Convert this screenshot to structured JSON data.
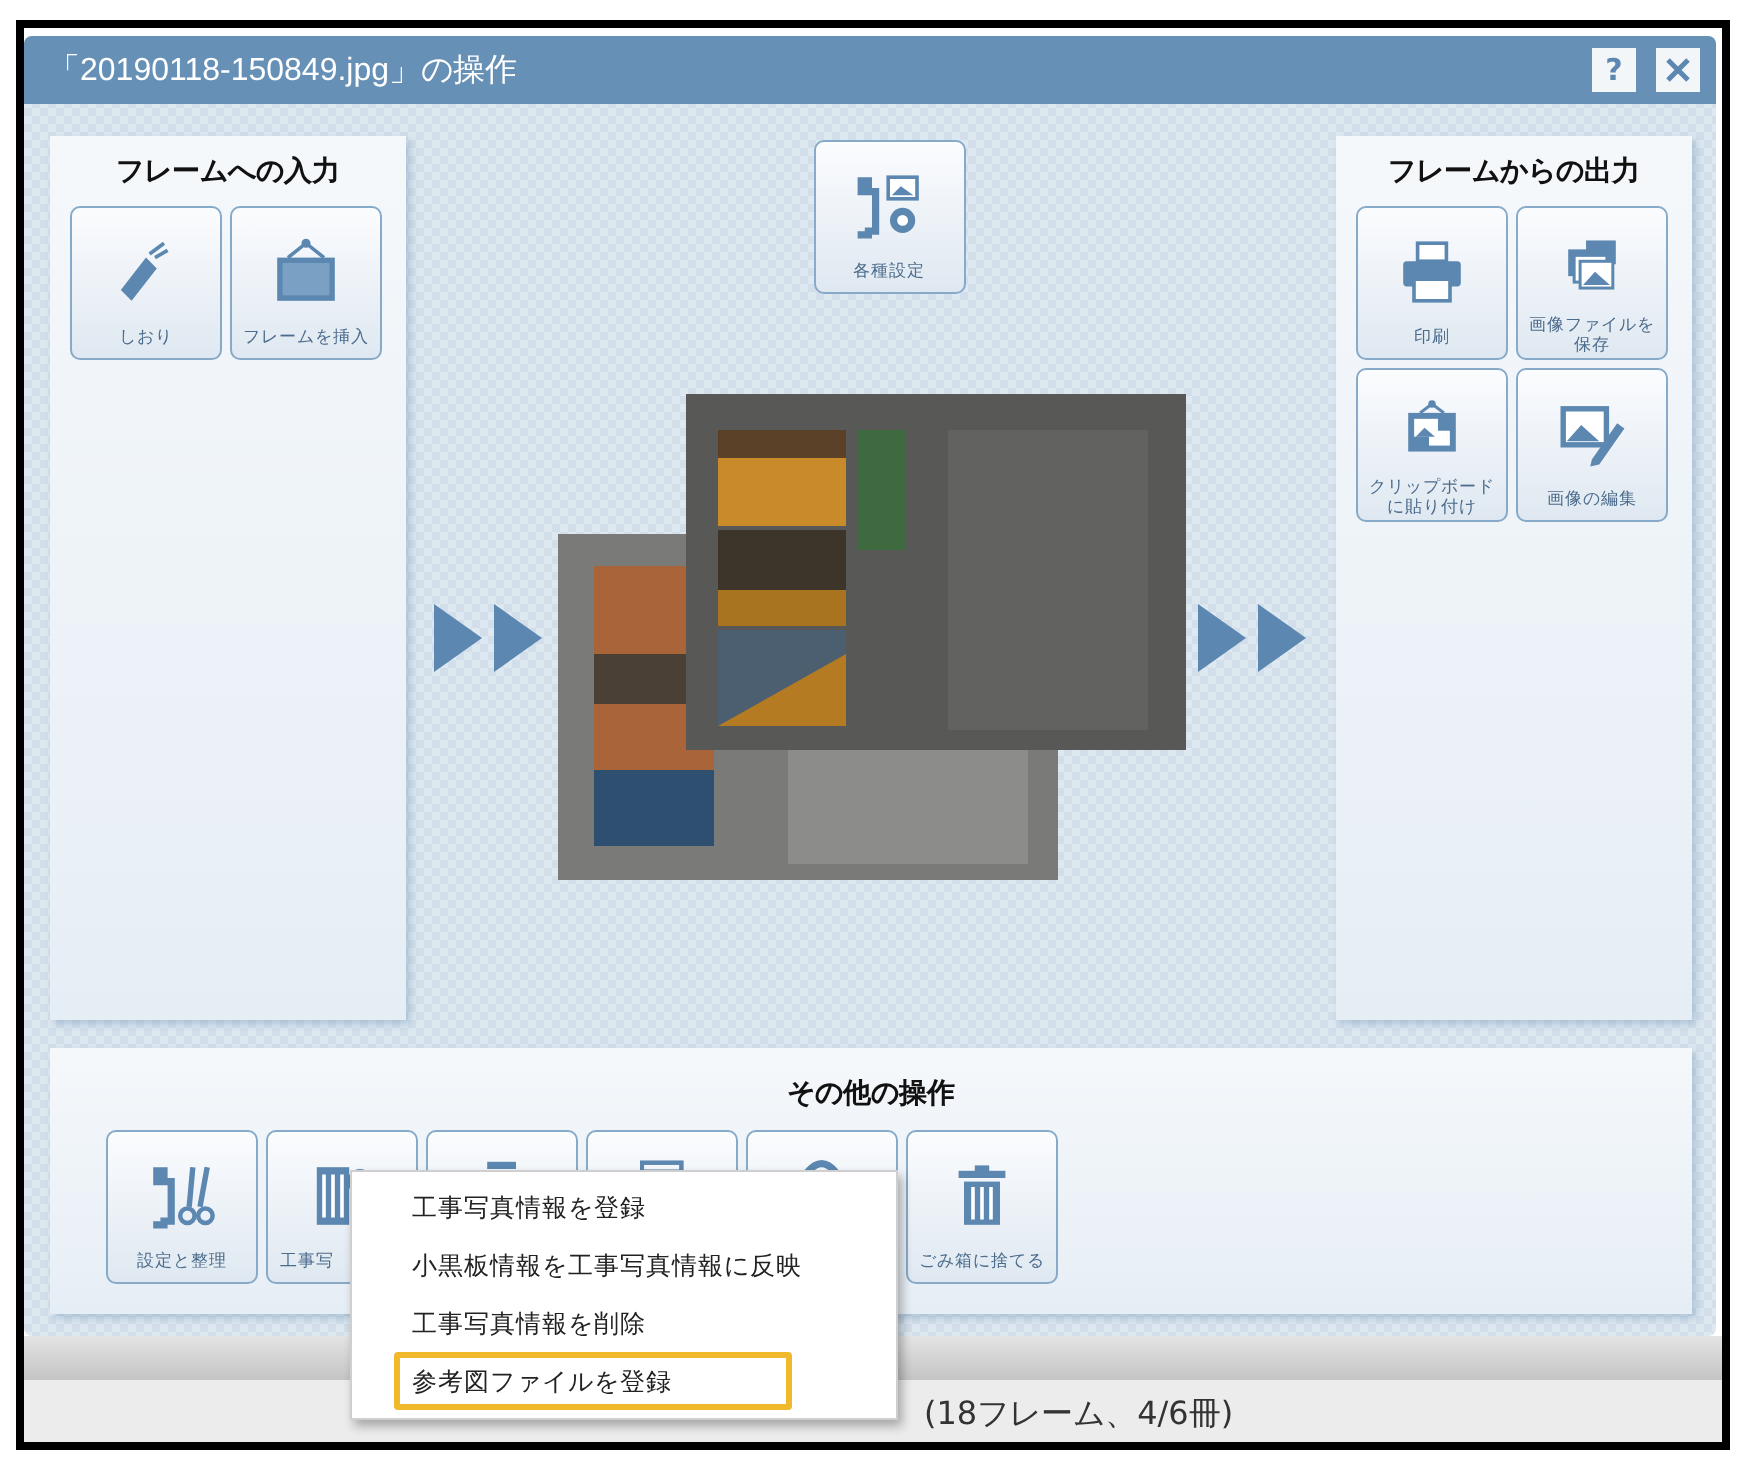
{
  "window": {
    "title": "「20190118-150849.jpg」の操作",
    "help_button": "?"
  },
  "input_panel": {
    "title": "フレームへの入力",
    "buttons": [
      {
        "kind": "bookmark",
        "label": "しおり"
      },
      {
        "kind": "frame",
        "label": "フレームを挿入"
      }
    ]
  },
  "settings_button": {
    "kind": "settings",
    "label": "各種設定"
  },
  "output_panel": {
    "title": "フレームからの出力",
    "buttons": [
      {
        "kind": "printer",
        "label": "印刷"
      },
      {
        "kind": "images",
        "label": "画像ファイルを保存"
      },
      {
        "kind": "clipboard",
        "label": "クリップボードに貼り付け"
      },
      {
        "kind": "edit",
        "label": "画像の編集"
      }
    ]
  },
  "other_panel": {
    "title": "その他の操作",
    "buttons": [
      {
        "kind": "tools",
        "label": "設定と整理"
      },
      {
        "kind": "building",
        "label": "工事写",
        "covered": true
      },
      {
        "kind": "document"
      },
      {
        "kind": "board"
      },
      {
        "kind": "clip"
      },
      {
        "kind": "trash",
        "label": "ごみ箱に捨てる"
      }
    ]
  },
  "context_menu": {
    "items": [
      {
        "label": "工事写真情報を登録",
        "selected": false
      },
      {
        "label": "小黒板情報を工事写真情報に反映",
        "selected": false
      },
      {
        "label": "工事写真情報を削除",
        "selected": false
      },
      {
        "label": "参考図ファイルを登録",
        "selected": true
      }
    ]
  },
  "background_window": {
    "status_text": "(18フレーム、4/6冊)"
  }
}
